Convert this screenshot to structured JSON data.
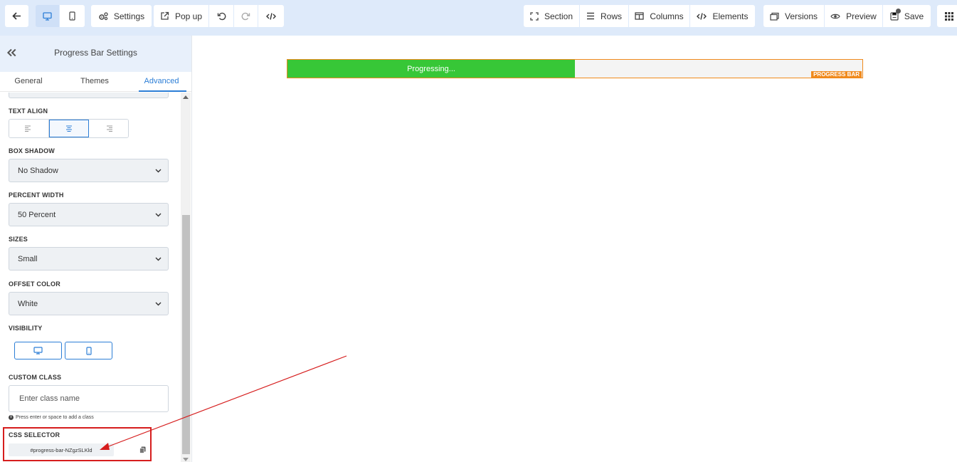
{
  "toolbar": {
    "settings_label": "Settings",
    "popup_label": "Pop up",
    "section_label": "Section",
    "rows_label": "Rows",
    "columns_label": "Columns",
    "elements_label": "Elements",
    "versions_label": "Versions",
    "preview_label": "Preview",
    "save_label": "Save"
  },
  "sidebar": {
    "title": "Progress Bar Settings",
    "tabs": [
      {
        "label": "General"
      },
      {
        "label": "Themes"
      },
      {
        "label": "Advanced"
      }
    ],
    "text_align": {
      "label": "TEXT ALIGN",
      "selected": "center"
    },
    "box_shadow": {
      "label": "BOX SHADOW",
      "value": "No Shadow"
    },
    "percent_width": {
      "label": "PERCENT WIDTH",
      "value": "50 Percent"
    },
    "sizes": {
      "label": "SIZES",
      "value": "Small"
    },
    "offset_color": {
      "label": "OFFSET COLOR",
      "value": "White"
    },
    "visibility": {
      "label": "VISIBILITY"
    },
    "custom_class": {
      "label": "CUSTOM CLASS",
      "placeholder": "Enter class name",
      "hint": "Press enter or space to add a class"
    },
    "css_selector": {
      "label": "CSS SELECTOR",
      "value": "#progress-bar-NZgzSLKld"
    }
  },
  "canvas": {
    "progress_bar": {
      "text": "Progressing...",
      "percent": 50,
      "tag": "PROGRESS BAR",
      "fill_color": "#37c737",
      "border_color": "#f08a1c"
    }
  },
  "colors": {
    "accent": "#2c7ed6",
    "annotation": "#d61d1d"
  }
}
